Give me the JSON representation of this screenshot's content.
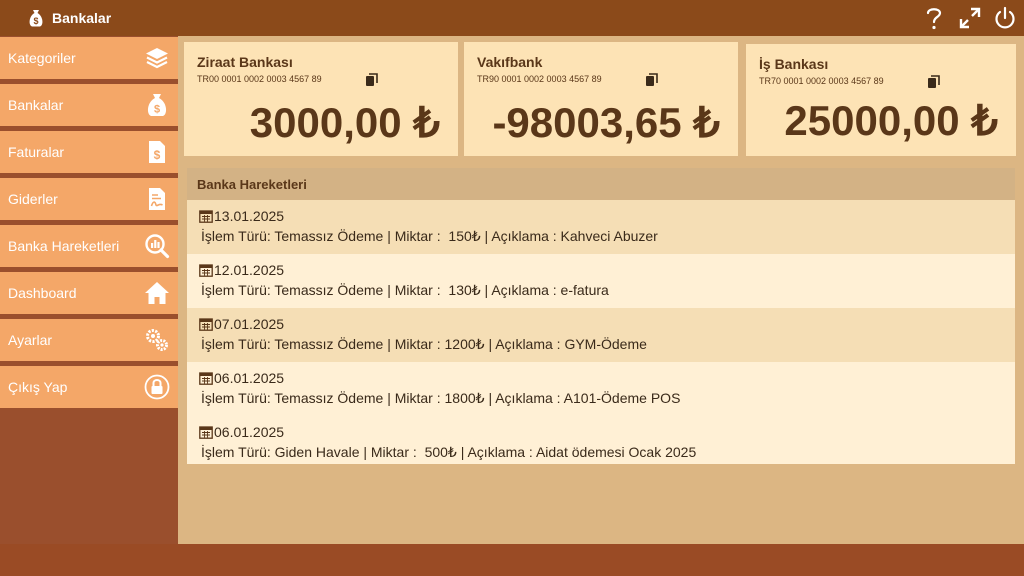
{
  "app": {
    "title": "Bankalar"
  },
  "sidebar": {
    "items": [
      {
        "label": "Kategoriler",
        "icon": "layers-icon"
      },
      {
        "label": "Bankalar",
        "icon": "money-bag-icon"
      },
      {
        "label": "Faturalar",
        "icon": "invoice-icon"
      },
      {
        "label": "Giderler",
        "icon": "expense-document-icon"
      },
      {
        "label": "Banka Hareketleri",
        "icon": "chart-search-icon"
      },
      {
        "label": "Dashboard",
        "icon": "home-icon"
      },
      {
        "label": "Ayarlar",
        "icon": "gears-icon"
      },
      {
        "label": "Çıkış Yap",
        "icon": "lock-icon"
      }
    ]
  },
  "banks": [
    {
      "name": "Ziraat Bankası",
      "iban": "TR00 0001 0002 0003 4567 89",
      "balance": "3000,00 ₺"
    },
    {
      "name": "Vakıfbank",
      "iban": "TR90 0001 0002 0003 4567 89",
      "balance": "-98003,65 ₺"
    },
    {
      "name": "İş Bankası",
      "iban": "TR70 0001 0002 0003 4567 89",
      "balance": "25000,00 ₺"
    }
  ],
  "transactions": {
    "title": "Banka Hareketleri",
    "rows": [
      {
        "date": "13.01.2025",
        "detail": "İşlem Türü: Temassız Ödeme | Miktar :  150₺ | Açıklama : Kahveci Abuzer"
      },
      {
        "date": "12.01.2025",
        "detail": "İşlem Türü: Temassız Ödeme | Miktar :  130₺ | Açıklama : e-fatura"
      },
      {
        "date": "07.01.2025",
        "detail": "İşlem Türü: Temassız Ödeme | Miktar : 1200₺ | Açıklama : GYM-Ödeme"
      },
      {
        "date": "06.01.2025",
        "detail": "İşlem Türü: Temassız Ödeme | Miktar : 1800₺ | Açıklama : A101-Ödeme POS"
      },
      {
        "date": "06.01.2025",
        "detail": "İşlem Türü: Giden Havale | Miktar :  500₺ | Açıklama : Aidat ödemesi Ocak 2025"
      }
    ]
  },
  "colors": {
    "titlebar": "#8b4a1a",
    "sidebar_bg": "#9a4f2d",
    "nav_item": "#f4a768",
    "content_bg": "#dcb683",
    "card_bg": "#fde3b5",
    "balance_text": "#5a3719"
  }
}
